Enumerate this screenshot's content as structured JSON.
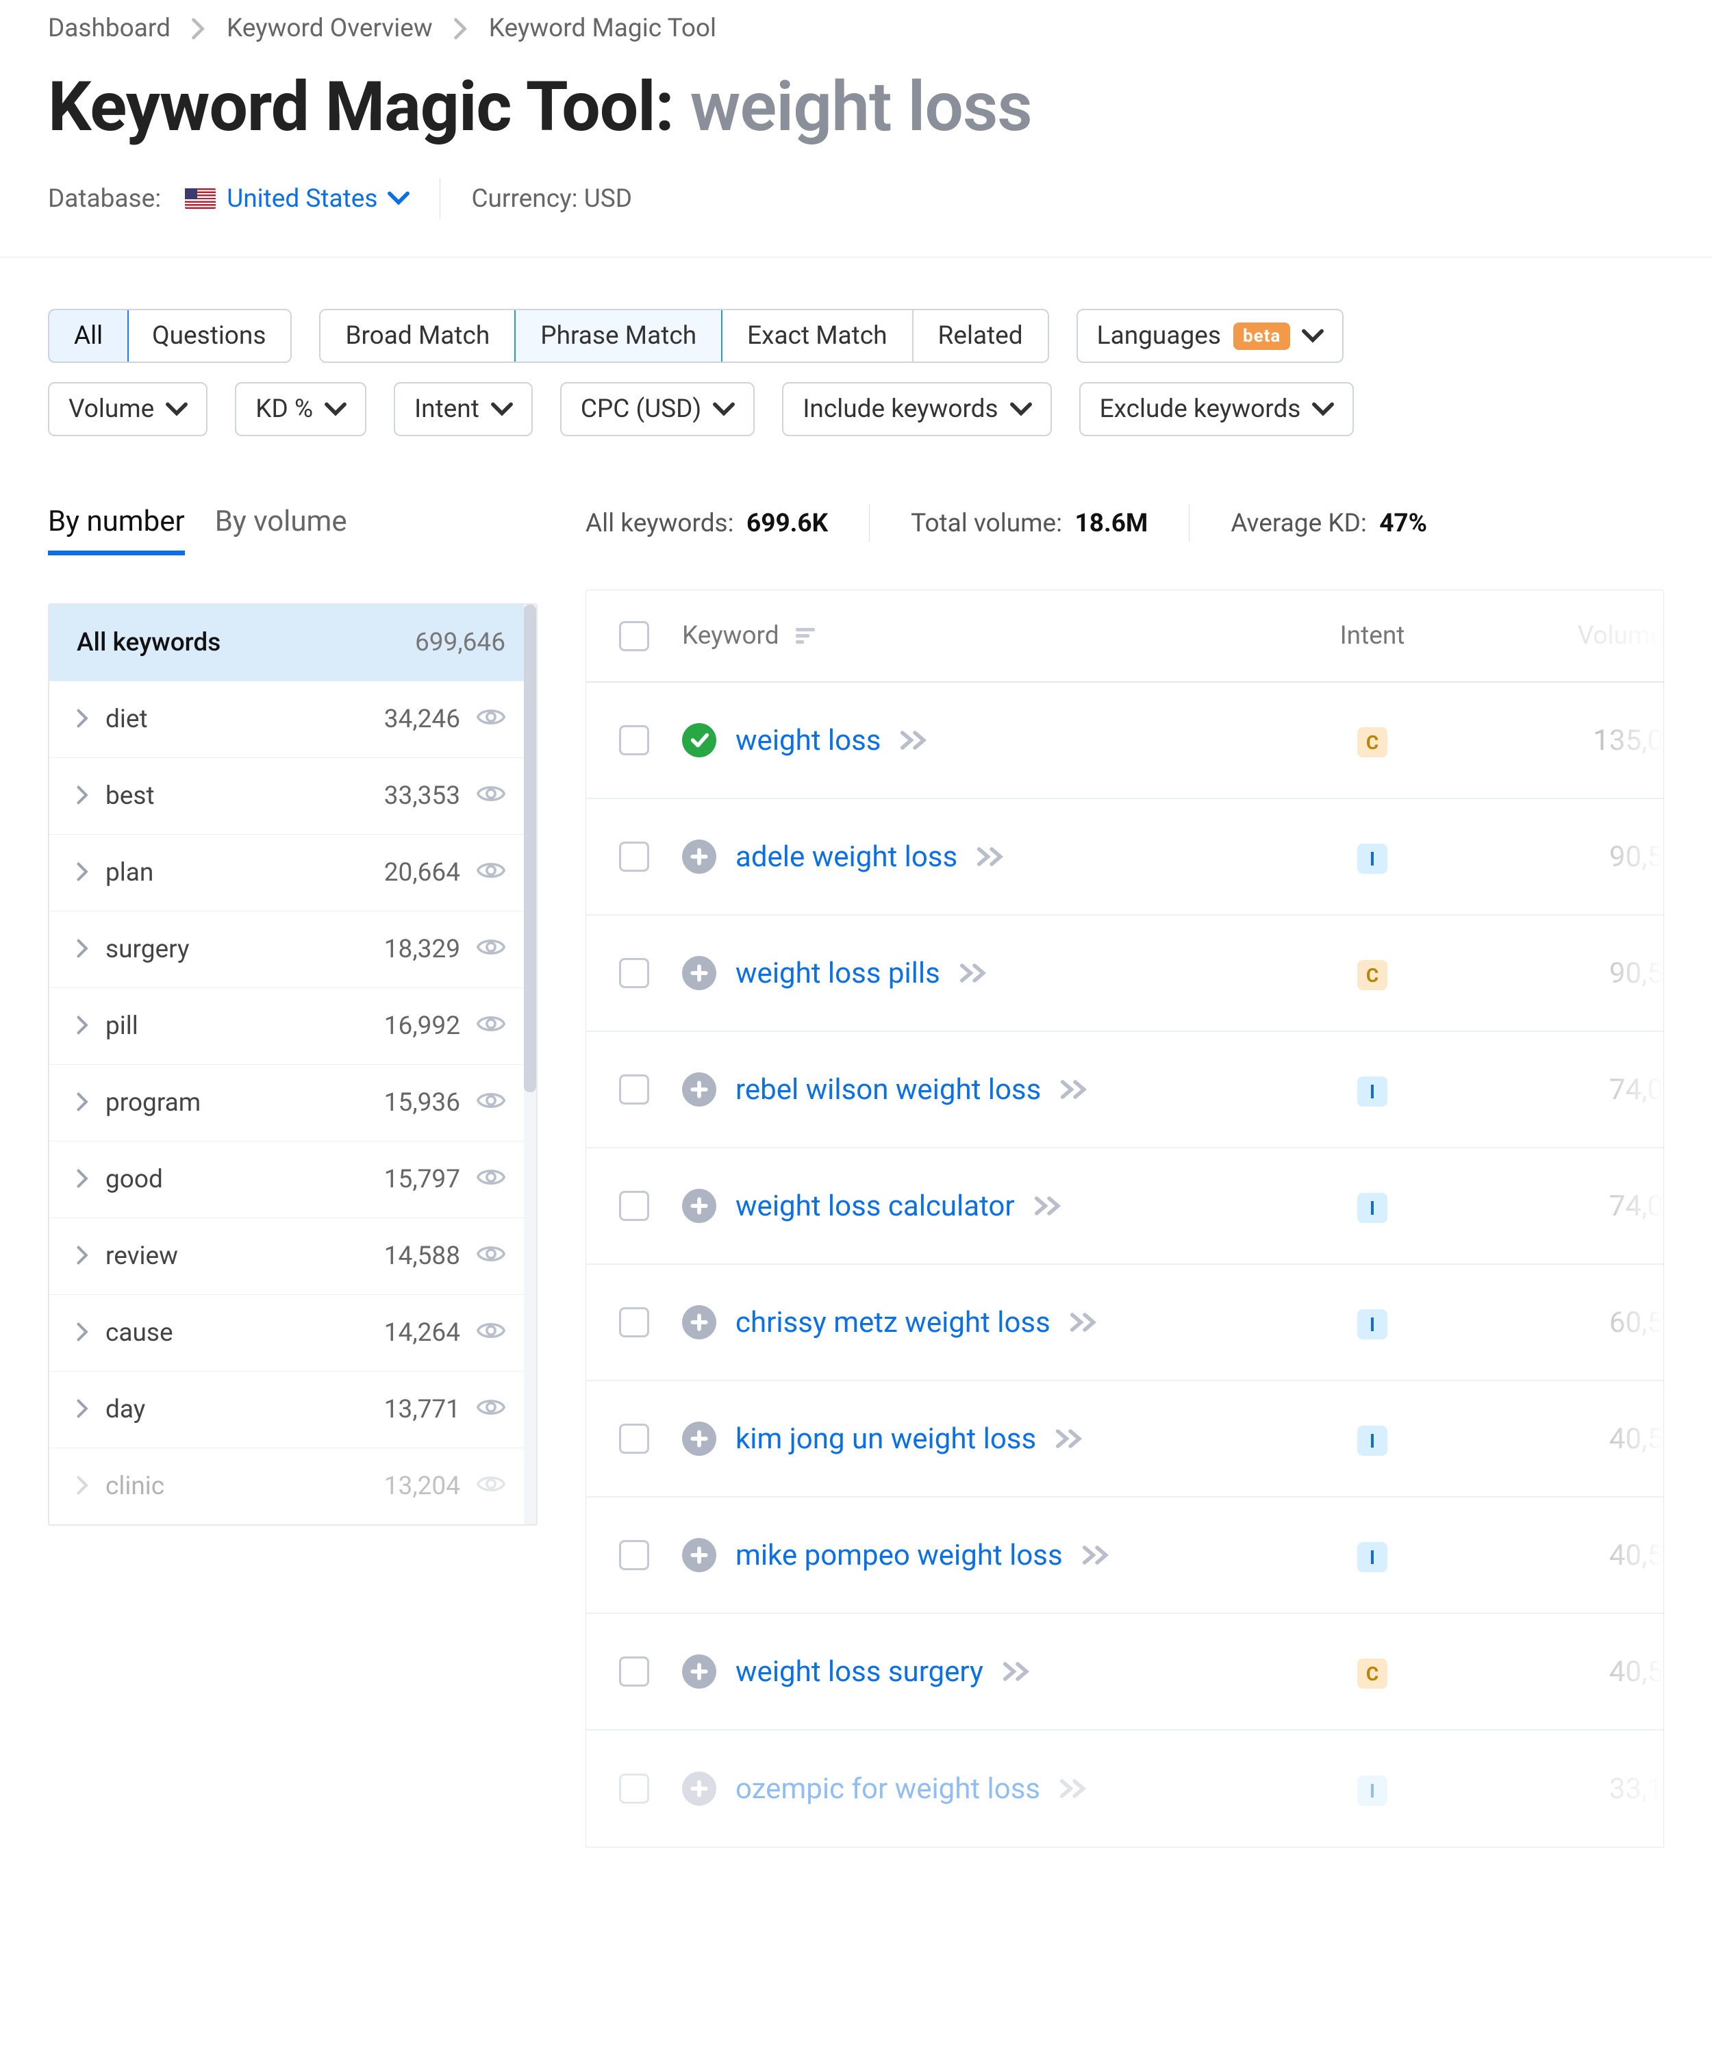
{
  "breadcrumb": {
    "items": [
      "Dashboard",
      "Keyword Overview",
      "Keyword Magic Tool"
    ]
  },
  "title": {
    "prefix": "Keyword Magic Tool: ",
    "term": "weight loss"
  },
  "meta": {
    "database_label": "Database:",
    "database_value": "United States",
    "currency_label": "Currency:",
    "currency_value": "USD"
  },
  "filters": {
    "qa_tabs": [
      "All",
      "Questions"
    ],
    "match_tabs": [
      "Broad Match",
      "Phrase Match",
      "Exact Match",
      "Related"
    ],
    "active_qa": "All",
    "active_match": "Phrase Match",
    "languages_label": "Languages",
    "beta_label": "beta",
    "chips": [
      "Volume",
      "KD %",
      "Intent",
      "CPC (USD)",
      "Include keywords",
      "Exclude keywords"
    ]
  },
  "left_tabs": {
    "items": [
      "By number",
      "By volume"
    ],
    "active": "By number"
  },
  "side_panel": {
    "head_label": "All keywords",
    "head_count": "699,646",
    "rows": [
      {
        "label": "diet",
        "count": "34,246"
      },
      {
        "label": "best",
        "count": "33,353"
      },
      {
        "label": "plan",
        "count": "20,664"
      },
      {
        "label": "surgery",
        "count": "18,329"
      },
      {
        "label": "pill",
        "count": "16,992"
      },
      {
        "label": "program",
        "count": "15,936"
      },
      {
        "label": "good",
        "count": "15,797"
      },
      {
        "label": "review",
        "count": "14,588"
      },
      {
        "label": "cause",
        "count": "14,264"
      },
      {
        "label": "day",
        "count": "13,771"
      },
      {
        "label": "clinic",
        "count": "13,204"
      }
    ]
  },
  "stats": {
    "all_label": "All keywords:",
    "all_value": "699.6K",
    "vol_label": "Total volume:",
    "vol_value": "18.6M",
    "kd_label": "Average KD:",
    "kd_value": "47%"
  },
  "table": {
    "headers": {
      "keyword": "Keyword",
      "intent": "Intent",
      "volume": "Volume"
    },
    "rows": [
      {
        "seed": true,
        "keyword": "weight loss",
        "intent": "C",
        "volume": "135,0"
      },
      {
        "seed": false,
        "keyword": "adele weight loss",
        "intent": "I",
        "volume": "90,5"
      },
      {
        "seed": false,
        "keyword": "weight loss pills",
        "intent": "C",
        "volume": "90,5"
      },
      {
        "seed": false,
        "keyword": "rebel wilson weight loss",
        "intent": "I",
        "volume": "74,0"
      },
      {
        "seed": false,
        "keyword": "weight loss calculator",
        "intent": "I",
        "volume": "74,0"
      },
      {
        "seed": false,
        "keyword": "chrissy metz weight loss",
        "intent": "I",
        "volume": "60,5"
      },
      {
        "seed": false,
        "keyword": "kim jong un weight loss",
        "intent": "I",
        "volume": "40,5"
      },
      {
        "seed": false,
        "keyword": "mike pompeo weight loss",
        "intent": "I",
        "volume": "40,5"
      },
      {
        "seed": false,
        "keyword": "weight loss surgery",
        "intent": "C",
        "volume": "40,5"
      },
      {
        "seed": false,
        "keyword": "ozempic for weight loss",
        "intent": "I",
        "volume": "33,1",
        "fade": true
      }
    ]
  }
}
